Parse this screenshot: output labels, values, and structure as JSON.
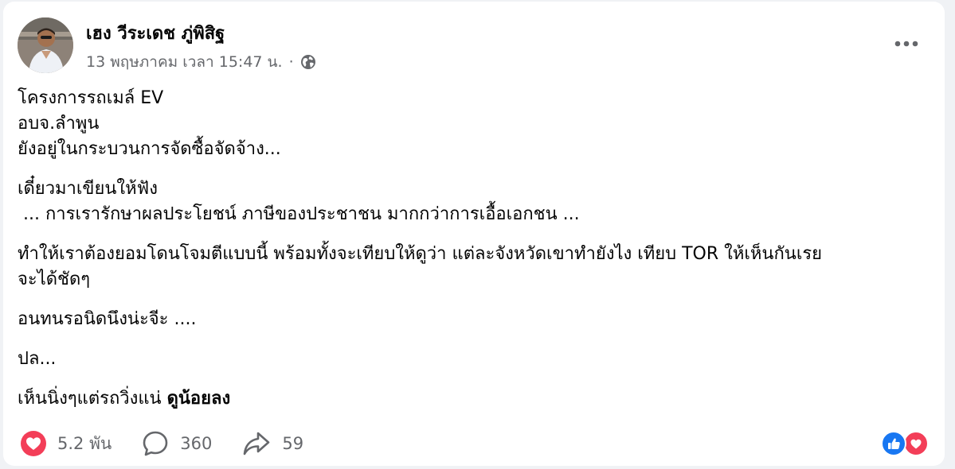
{
  "post": {
    "author": "เฮง วีระเดช ภู่พิสิฐ",
    "timestamp": "13 พฤษภาคม เวลา 15:47 น.",
    "separator": "·",
    "privacy_icon": "globe-icon",
    "more_icon": "more-options-icon",
    "lines": [
      "โครงการรถเมล์ EV",
      "อบจ.ลำพูน",
      "ยังอยู่ในกระบวนการจัดซื้อจัดจ้าง...",
      "เดี๋ยวมาเขียนให้ฟัง",
      " ... การเรารักษาผลประโยชน์ ภาษีของประชาชน มากกว่าการเอื้อเอกชน ...",
      "ทำให้เราต้องยอมโดนโจมตีแบบนี้ พร้อมทั้งจะเทียบให้ดูว่า แต่ละจังหวัดเขาทำยังไง เทียบ TOR ให้เห็นกันเรย",
      "จะได้ชัดๆ",
      "อนทนรอนิดนึงน่ะจีะ ....",
      "ปล...",
      "เห็นนิ่งๆแต่รถวิ่งแน่ "
    ],
    "mention": "ดูน้อยลง"
  },
  "stats": {
    "reactions_count": "5.2 พัน",
    "comments_count": "360",
    "shares_count": "59"
  },
  "icons": {
    "reaction": "heart-reaction-icon",
    "comment": "comment-icon",
    "share": "share-icon",
    "like": "like-reaction-icon",
    "love": "love-reaction-icon"
  },
  "colors": {
    "love_red": "#f33e58",
    "like_blue": "#1877f2",
    "secondary_text": "#65676b"
  }
}
